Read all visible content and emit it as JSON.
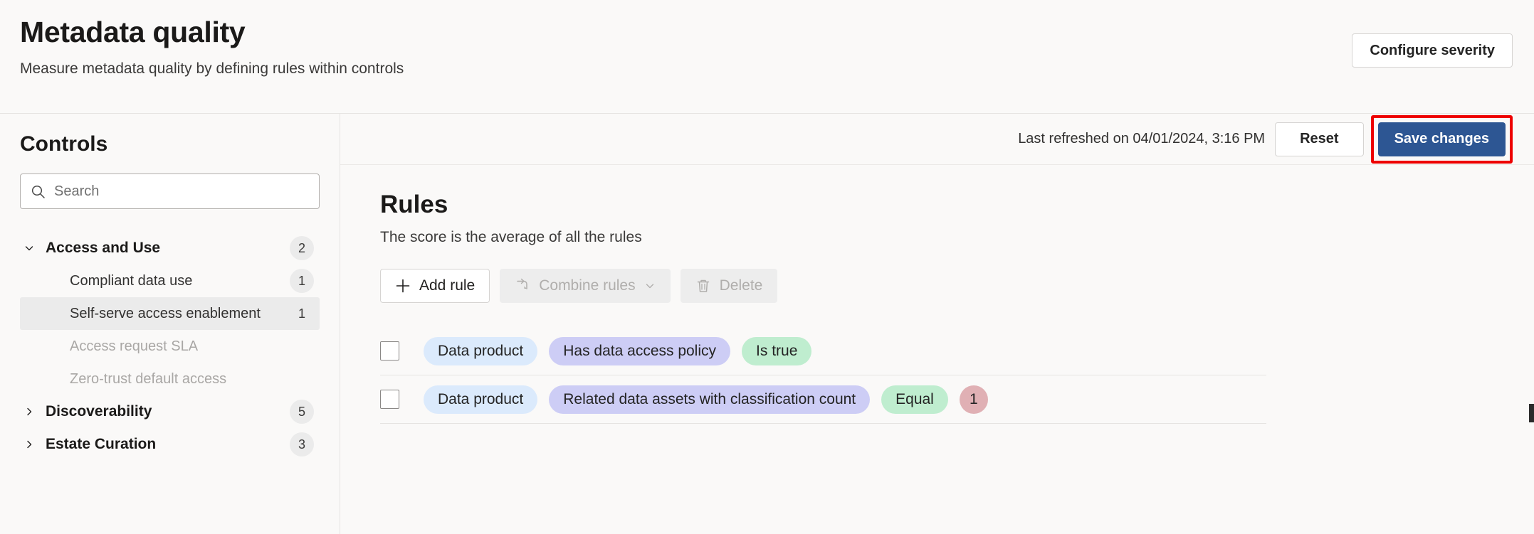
{
  "header": {
    "title": "Metadata quality",
    "subtitle": "Measure metadata quality by defining rules within controls",
    "configure_severity_label": "Configure severity"
  },
  "toolbar": {
    "last_refreshed": "Last refreshed on 04/01/2024, 3:16 PM",
    "reset_label": "Reset",
    "save_label": "Save changes",
    "save_highlight_color": "#ee0000",
    "save_button_color": "#2d5693"
  },
  "sidebar": {
    "title": "Controls",
    "search": {
      "value": "",
      "placeholder": "Search",
      "icon": "search-icon"
    },
    "groups": [
      {
        "label": "Access and Use",
        "count": "2",
        "expanded": true,
        "chevron": "chevron-down-icon",
        "children": [
          {
            "label": "Compliant data use",
            "count": "1",
            "selected": false,
            "disabled": false
          },
          {
            "label": "Self-serve access enablement",
            "count": "1",
            "selected": true,
            "disabled": false
          },
          {
            "label": "Access request SLA",
            "count": "",
            "selected": false,
            "disabled": true
          },
          {
            "label": "Zero-trust default access",
            "count": "",
            "selected": false,
            "disabled": true
          }
        ]
      },
      {
        "label": "Discoverability",
        "count": "5",
        "expanded": false,
        "chevron": "chevron-right-icon",
        "children": []
      },
      {
        "label": "Estate Curation",
        "count": "3",
        "expanded": false,
        "chevron": "chevron-right-icon",
        "children": []
      }
    ]
  },
  "main": {
    "rules_title": "Rules",
    "rules_subtitle": "The score is the average of all the rules",
    "actions": [
      {
        "label": "Add rule",
        "icon": "plus-icon",
        "disabled": false
      },
      {
        "label": "Combine rules",
        "icon": "merge-icon",
        "disabled": true,
        "caret": "chevron-down-icon"
      },
      {
        "label": "Delete",
        "icon": "trash-icon",
        "disabled": true
      }
    ],
    "rules": [
      {
        "checked": false,
        "entity": "Data product",
        "attribute": "Has data access policy",
        "operator": "Is true",
        "value": ""
      },
      {
        "checked": false,
        "entity": "Data product",
        "attribute": "Related data assets with classification count",
        "operator": "Equal",
        "value": "1"
      }
    ]
  }
}
